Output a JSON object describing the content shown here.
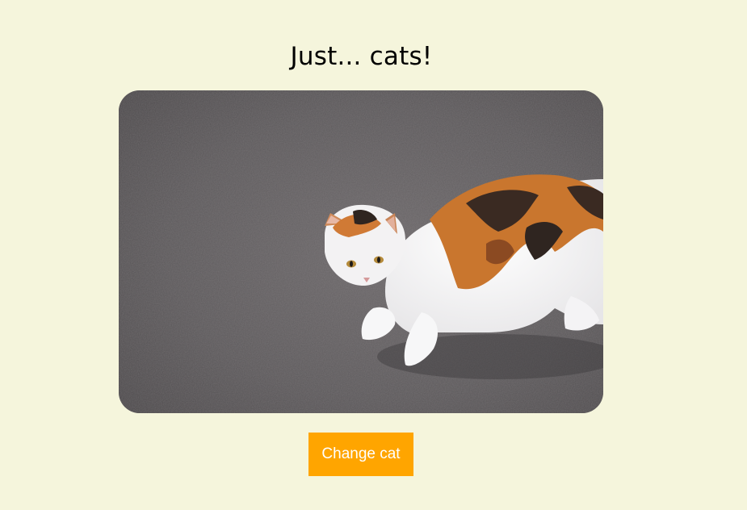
{
  "page": {
    "title": "Just... cats!",
    "background_color": "#f5f5dc"
  },
  "image": {
    "subject": "calico-cat-photo",
    "alt": "cat"
  },
  "button": {
    "label": "Change cat",
    "color": "#ffa500",
    "text_color": "#ffffff"
  }
}
